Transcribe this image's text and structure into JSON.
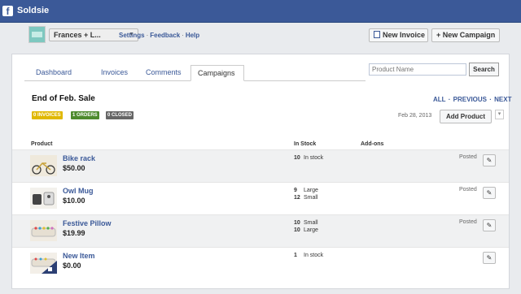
{
  "app": {
    "title": "Soldsie"
  },
  "header": {
    "store_name": "Frances + L...",
    "links": [
      "Settings",
      "Feedback",
      "Help"
    ],
    "new_invoice_label": "New Invoice",
    "new_campaign_label": "+ New Campaign"
  },
  "tabs": [
    "Dashboard",
    "Invoices",
    "Comments",
    "Campaigns"
  ],
  "active_tab": "Campaigns",
  "search": {
    "placeholder": "Product Name",
    "button_label": "Search"
  },
  "campaign": {
    "title": "End of Feb. Sale",
    "pager": [
      "ALL",
      "PREVIOUS",
      "NEXT"
    ],
    "badges": {
      "invoices": "0 INVOICES",
      "orders": "1 ORDERS",
      "closed": "0 CLOSED"
    },
    "date": "Feb 28, 2013",
    "add_product_label": "Add Product"
  },
  "table": {
    "columns": {
      "product": "Product",
      "in_stock": "In Stock",
      "addons": "Add-ons"
    },
    "rows": [
      {
        "name": "Bike rack",
        "price": "$50.00",
        "stock": [
          {
            "qty": "10",
            "label": "In stock"
          }
        ],
        "status": "Posted"
      },
      {
        "name": "Owl Mug",
        "price": "$10.00",
        "stock": [
          {
            "qty": "9",
            "label": "Large"
          },
          {
            "qty": "12",
            "label": "Small"
          }
        ],
        "status": "Posted"
      },
      {
        "name": "Festive Pillow",
        "price": "$19.99",
        "stock": [
          {
            "qty": "10",
            "label": "Small"
          },
          {
            "qty": "10",
            "label": "Large"
          }
        ],
        "status": "Posted"
      },
      {
        "name": "New Item",
        "price": "$0.00",
        "stock": [
          {
            "qty": "1",
            "label": "In stock"
          }
        ],
        "status": ""
      }
    ]
  },
  "icons": {
    "edit": "pencil-icon",
    "logo": "facebook-logo-icon",
    "document": "document-icon"
  },
  "colors": {
    "brand": "#3b5998",
    "badge_yellow": "#e0b800",
    "badge_green": "#4d8a2d",
    "badge_gray": "#666666"
  }
}
